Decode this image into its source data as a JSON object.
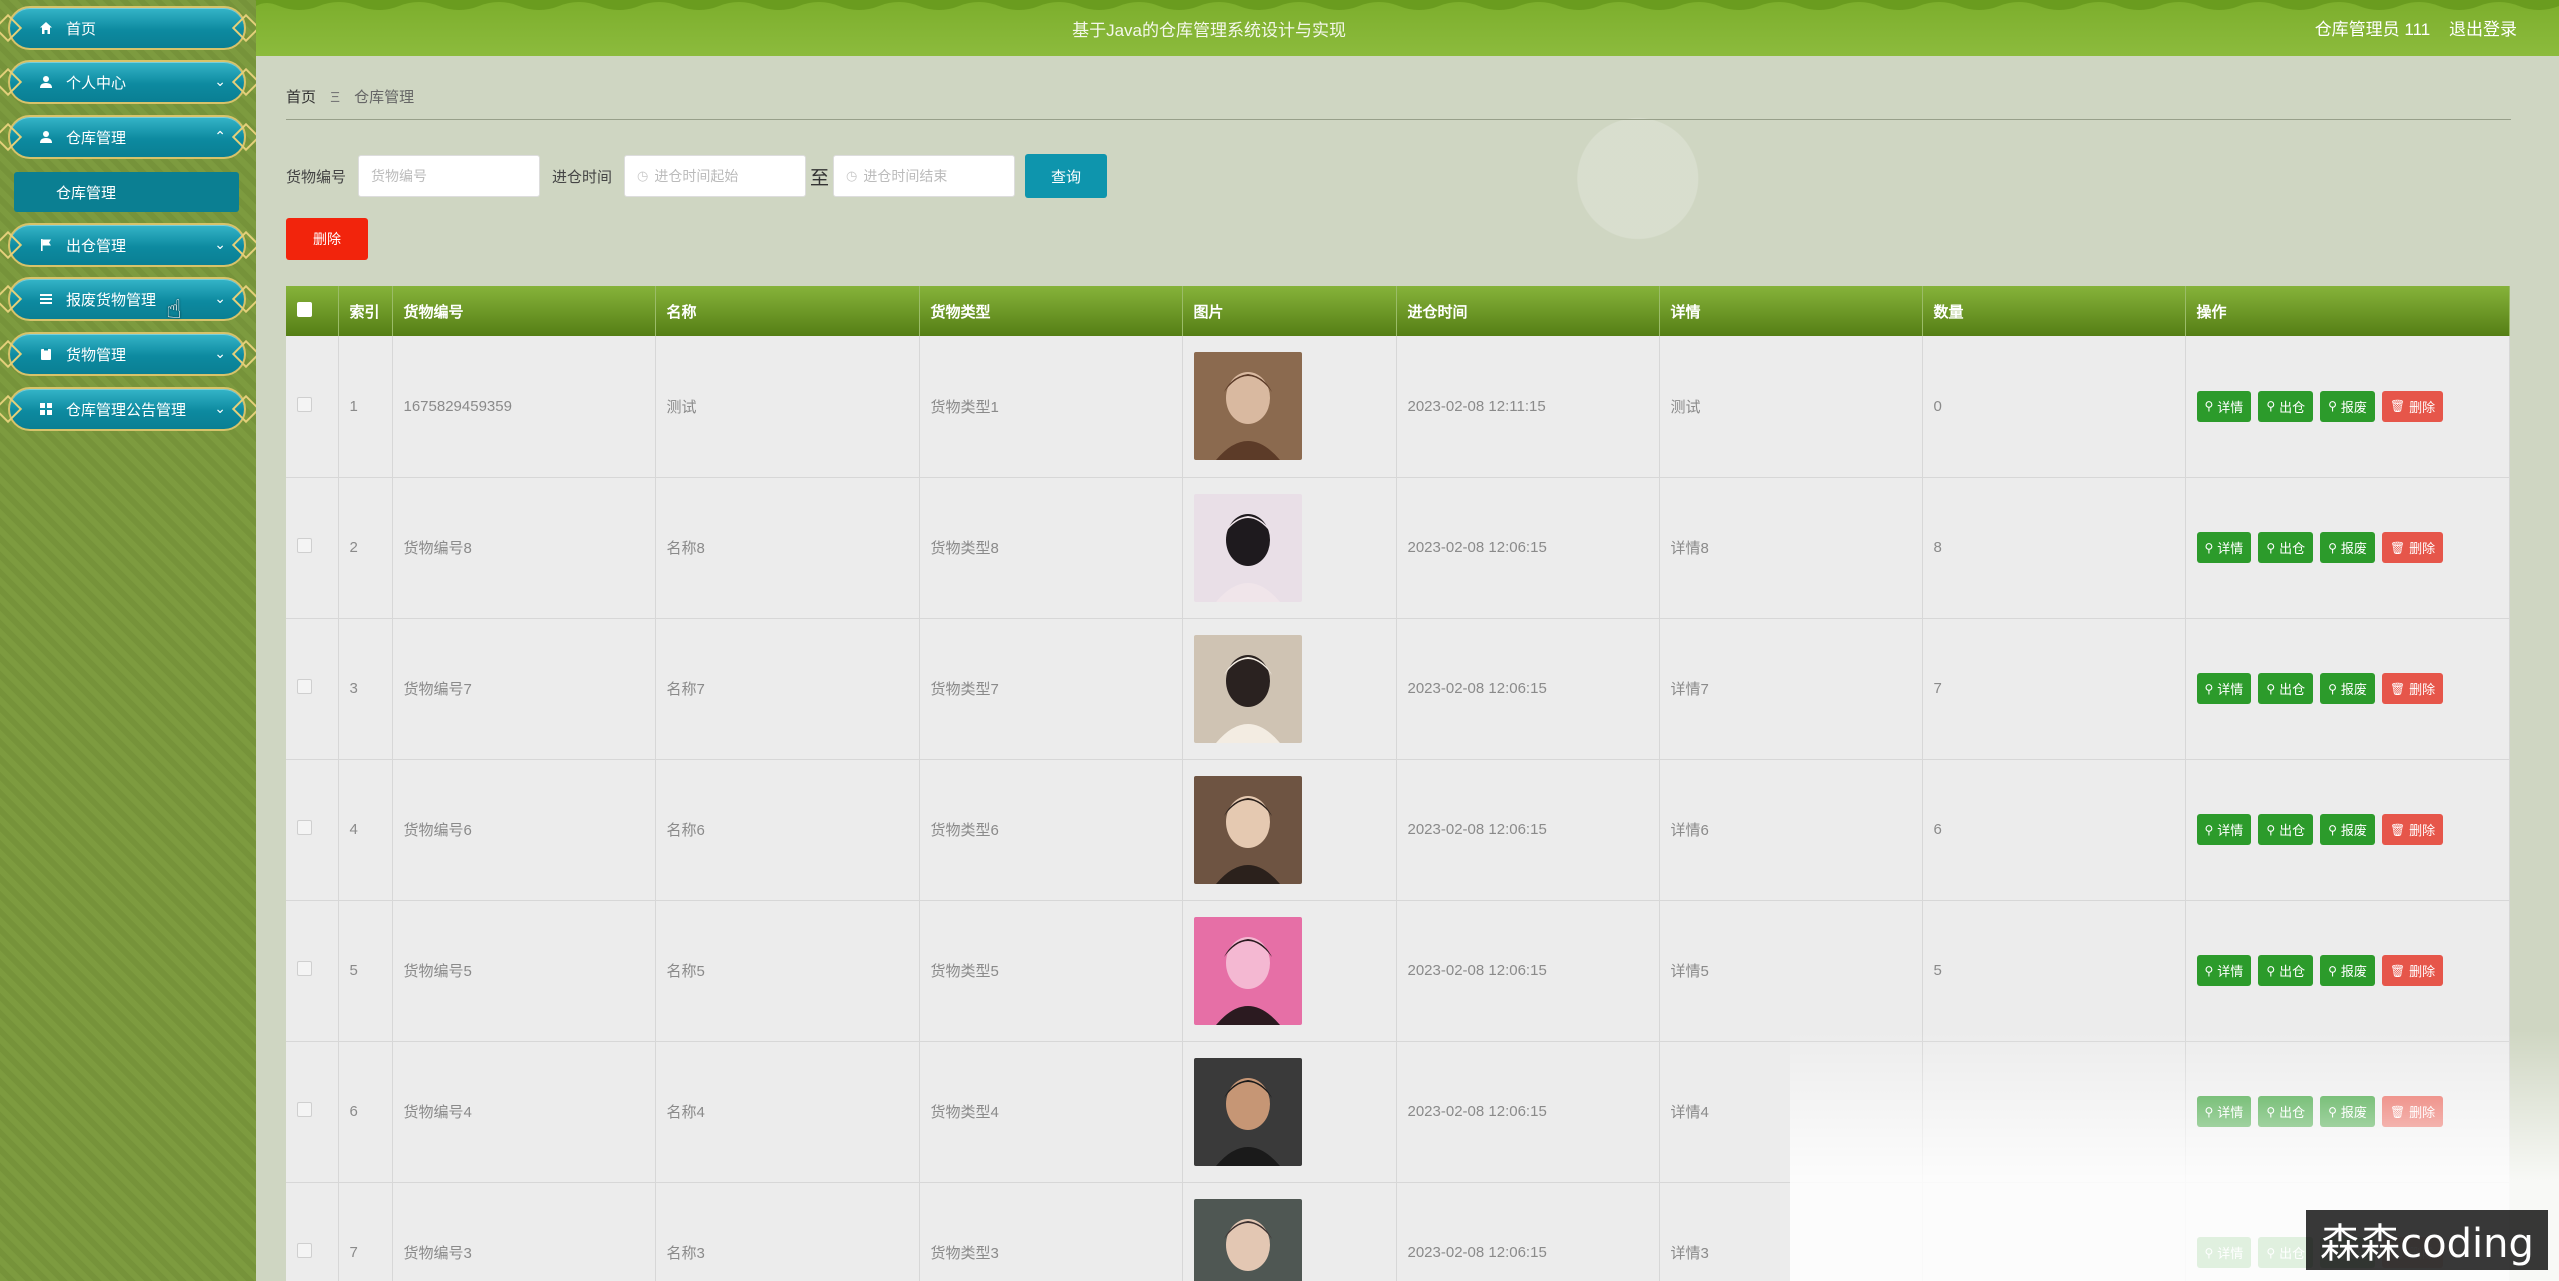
{
  "app": {
    "title": "基于Java的仓库管理系统设计与实现",
    "user": "仓库管理员 111",
    "logout": "退出登录"
  },
  "sidebar": {
    "items": [
      {
        "label": "首页",
        "icon": "home-icon"
      },
      {
        "label": "个人中心",
        "icon": "user-icon"
      },
      {
        "label": "仓库管理",
        "icon": "user-icon"
      },
      {
        "label": "出仓管理",
        "icon": "flag-icon"
      },
      {
        "label": "报废货物管理",
        "icon": "list-icon"
      },
      {
        "label": "货物管理",
        "icon": "clipboard-icon"
      },
      {
        "label": "仓库管理公告管理",
        "icon": "grid-icon"
      }
    ],
    "submenu": {
      "label": "仓库管理"
    }
  },
  "breadcrumb": {
    "home": "首页",
    "sep": "Ξ",
    "current": "仓库管理"
  },
  "search": {
    "code_label": "货物编号",
    "code_placeholder": "货物编号",
    "time_label": "进仓时间",
    "start_placeholder": "进仓时间起始",
    "to": "至",
    "end_placeholder": "进仓时间结束",
    "query_btn": "查询"
  },
  "actions": {
    "delete_btn": "删除"
  },
  "table": {
    "headers": [
      "索引",
      "货物编号",
      "名称",
      "货物类型",
      "图片",
      "进仓时间",
      "详情",
      "数量",
      "操作"
    ],
    "op_labels": {
      "detail": "详情",
      "out": "出仓",
      "scrap": "报废",
      "delete": "删除"
    },
    "rows": [
      {
        "index": "1",
        "code": "1675829459359",
        "name": "测试",
        "type": "货物类型1",
        "time": "2023-02-08 12:11:15",
        "detail": "测试",
        "qty": "0"
      },
      {
        "index": "2",
        "code": "货物编号8",
        "name": "名称8",
        "type": "货物类型8",
        "time": "2023-02-08 12:06:15",
        "detail": "详情8",
        "qty": "8"
      },
      {
        "index": "3",
        "code": "货物编号7",
        "name": "名称7",
        "type": "货物类型7",
        "time": "2023-02-08 12:06:15",
        "detail": "详情7",
        "qty": "7"
      },
      {
        "index": "4",
        "code": "货物编号6",
        "name": "名称6",
        "type": "货物类型6",
        "time": "2023-02-08 12:06:15",
        "detail": "详情6",
        "qty": "6"
      },
      {
        "index": "5",
        "code": "货物编号5",
        "name": "名称5",
        "type": "货物类型5",
        "time": "2023-02-08 12:06:15",
        "detail": "详情5",
        "qty": "5"
      },
      {
        "index": "6",
        "code": "货物编号4",
        "name": "名称4",
        "type": "货物类型4",
        "time": "2023-02-08 12:06:15",
        "detail": "详情4",
        "qty": ""
      },
      {
        "index": "7",
        "code": "货物编号3",
        "name": "名称3",
        "type": "货物类型3",
        "time": "2023-02-08 12:06:15",
        "detail": "详情3",
        "qty": ""
      }
    ]
  },
  "watermark": "森森coding",
  "colors": {
    "sidebar_bg": "#7d9b3f",
    "menu_teal": "#0d8aa0",
    "header_green": "#8cbb3d",
    "table_header": "#6c9a28",
    "btn_green": "#2c9b2b",
    "btn_red": "#e6564a",
    "delete_red": "#f2240c",
    "query_teal": "#0e95ad"
  }
}
